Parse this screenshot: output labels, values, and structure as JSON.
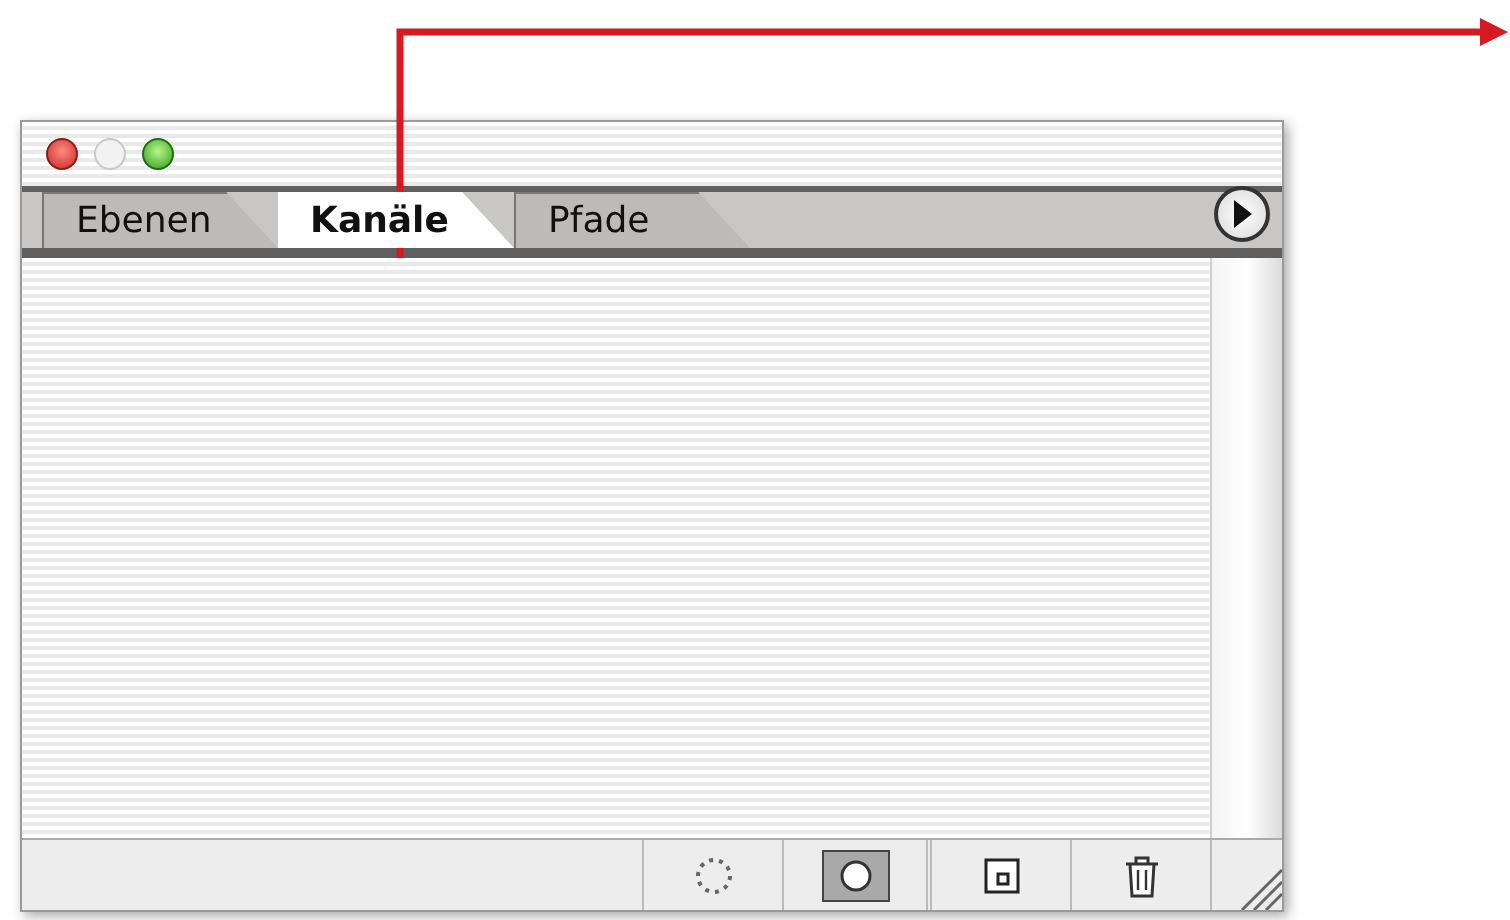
{
  "panel": {
    "tabs": [
      {
        "label": "Ebenen",
        "selected": false
      },
      {
        "label": "Kanäle",
        "selected": true
      },
      {
        "label": "Pfade",
        "selected": false
      }
    ]
  }
}
